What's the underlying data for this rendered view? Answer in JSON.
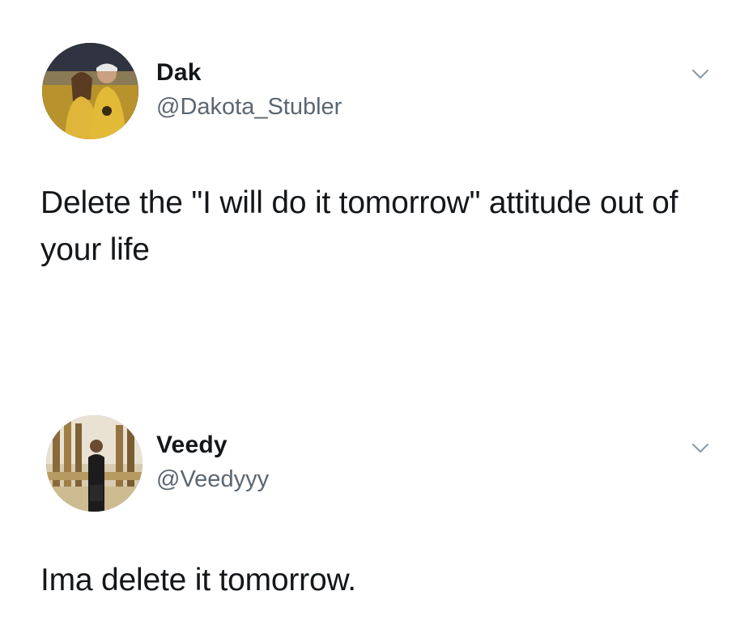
{
  "tweets": [
    {
      "author": {
        "name": "Dak",
        "handle": "@Dakota_Stubler"
      },
      "text": "Delete the \"I will do it tomorrow\" attitude out of your life",
      "menu_icon": "chevron-down-icon"
    },
    {
      "author": {
        "name": "Veedy",
        "handle": "@Veedyyy"
      },
      "text": "Ima delete it tomorrow.",
      "menu_icon": "chevron-down-icon"
    }
  ],
  "colors": {
    "text_primary": "#14171a",
    "text_secondary": "#5b6670",
    "background": "#ffffff",
    "chevron": "#8899a6"
  }
}
